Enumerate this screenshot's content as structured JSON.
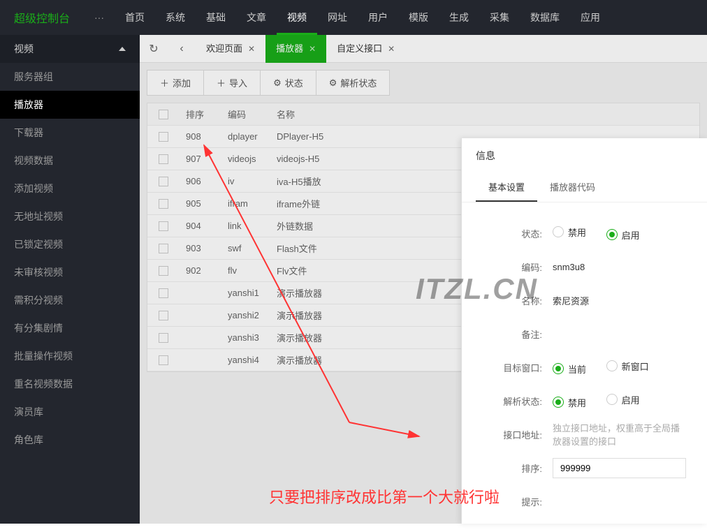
{
  "header": {
    "logo": "超级控制台",
    "dots": "···",
    "nav": [
      "首页",
      "系统",
      "基础",
      "文章",
      "视频",
      "网址",
      "用户",
      "模版",
      "生成",
      "采集",
      "数据库",
      "应用"
    ],
    "active_nav": "视频"
  },
  "sidebar": {
    "title": "视频",
    "items": [
      "服务器组",
      "播放器",
      "下载器",
      "视频数据",
      "添加视频",
      "无地址视频",
      "已锁定视频",
      "未审核视频",
      "需积分视频",
      "有分集剧情",
      "批量操作视频",
      "重名视频数据",
      "演员库",
      "角色库"
    ],
    "active": "播放器"
  },
  "tabs": {
    "refresh": "↻",
    "back": "‹",
    "items": [
      {
        "label": "欢迎页面",
        "closable": true,
        "active": false
      },
      {
        "label": "播放器",
        "closable": true,
        "active": true
      },
      {
        "label": "自定义接口",
        "closable": true,
        "active": false
      }
    ]
  },
  "toolbar": {
    "add": "添加",
    "import": "导入",
    "status": "状态",
    "parse_status": "解析状态"
  },
  "table": {
    "headers": {
      "sort": "排序",
      "code": "编码",
      "name": "名称"
    },
    "rows": [
      {
        "sort": "908",
        "code": "dplayer",
        "name": "DPlayer-H5"
      },
      {
        "sort": "907",
        "code": "videojs",
        "name": "videojs-H5"
      },
      {
        "sort": "906",
        "code": "iv",
        "name": "iva-H5播放"
      },
      {
        "sort": "905",
        "code": "ifram",
        "name": "iframe外链"
      },
      {
        "sort": "904",
        "code": "link",
        "name": "外链数据"
      },
      {
        "sort": "903",
        "code": "swf",
        "name": "Flash文件"
      },
      {
        "sort": "902",
        "code": "flv",
        "name": "Flv文件"
      },
      {
        "sort": "",
        "code": "yanshi1",
        "name": "演示播放器"
      },
      {
        "sort": "",
        "code": "yanshi2",
        "name": "演示播放器"
      },
      {
        "sort": "",
        "code": "yanshi3",
        "name": "演示播放器"
      },
      {
        "sort": "",
        "code": "yanshi4",
        "name": "演示播放器"
      }
    ]
  },
  "modal": {
    "title": "信息",
    "tabs": [
      "基本设置",
      "播放器代码"
    ],
    "active_tab": "基本设置",
    "fields": {
      "status_label": "状态:",
      "status_disable": "禁用",
      "status_enable": "启用",
      "code_label": "编码:",
      "code_value": "snm3u8",
      "name_label": "名称:",
      "name_value": "索尼资源",
      "remark_label": "备注:",
      "target_label": "目标窗口:",
      "target_current": "当前",
      "target_new": "新窗口",
      "parse_label": "解析状态:",
      "parse_disable": "禁用",
      "parse_enable": "启用",
      "api_label": "接口地址:",
      "api_placeholder": "独立接口地址，权重高于全局播放器设置的接口",
      "sort_label": "排序:",
      "sort_value": "999999",
      "tip_label": "提示:"
    }
  },
  "watermark": "ITZL.CN",
  "annotation": "只要把排序改成比第一个大就行啦"
}
